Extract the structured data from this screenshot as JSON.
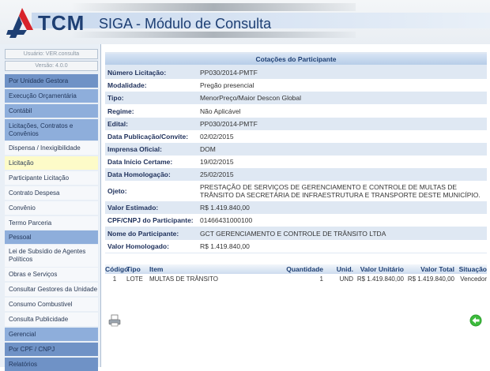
{
  "header": {
    "logo_text": "TCM",
    "title": "SIGA - Módulo de Consulta"
  },
  "sidebar": {
    "user": "Usuário: VER.consulta",
    "version": "Versão: 4.0.0",
    "items": [
      {
        "label": "Por Unidade Gestora"
      },
      {
        "label": "Execução Orçamentária"
      },
      {
        "label": "Contábil"
      },
      {
        "label": "Licitações, Contratos e Convênios"
      },
      {
        "label": "Dispensa / Inexigibilidade"
      },
      {
        "label": "Licitação"
      },
      {
        "label": "Participante Licitação"
      },
      {
        "label": "Contrato Despesa"
      },
      {
        "label": "Convênio"
      },
      {
        "label": "Termo Parceria"
      },
      {
        "label": "Pessoal"
      },
      {
        "label": "Lei de Subsídio de Agentes Políticos"
      },
      {
        "label": "Obras e Serviços"
      },
      {
        "label": "Consultar Gestores da Unidade"
      },
      {
        "label": "Consumo Combustivel"
      },
      {
        "label": "Consulta Publicidade"
      },
      {
        "label": "Gerencial"
      },
      {
        "label": "Por CPF / CNPJ"
      },
      {
        "label": "Relatórios"
      }
    ]
  },
  "main": {
    "title": "Cotações do Participante",
    "fields": [
      {
        "label": "Número Licitação:",
        "value": "PP030/2014-PMTF"
      },
      {
        "label": "Modalidade:",
        "value": "Pregão presencial"
      },
      {
        "label": "Tipo:",
        "value": "MenorPreço/Maior Descon Global"
      },
      {
        "label": "Regime:",
        "value": "Não Aplicável"
      },
      {
        "label": "Edital:",
        "value": "PP030/2014-PMTF"
      },
      {
        "label": "Data Publicação/Convite:",
        "value": "02/02/2015"
      },
      {
        "label": "Imprensa Oficial:",
        "value": "DOM"
      },
      {
        "label": "Data Início Certame:",
        "value": "19/02/2015"
      },
      {
        "label": "Data Homologação:",
        "value": "25/02/2015"
      },
      {
        "label": "Ojeto:",
        "value": "PRESTAÇÃO DE SERVIÇOS DE GERENCIAMENTO E CONTROLE DE MULTAS DE TRÂNSITO DA SECRETÁRIA DE INFRAESTRUTURA E TRANSPORTE DESTE MUNICÍPIO."
      },
      {
        "label": "Valor Estimado:",
        "value": "R$ 1.419.840,00"
      },
      {
        "label": "CPF/CNPJ do Participante:",
        "value": "01466431000100"
      },
      {
        "label": "Nome do Participante:",
        "value": "GCT GERENCIAMENTO E CONTROLE DE TRÂNSITO LTDA"
      },
      {
        "label": "Valor Homologado:",
        "value": "R$ 1.419.840,00"
      }
    ]
  },
  "items_table": {
    "columns": [
      "Código",
      "Tipo",
      "Item",
      "Quantidade",
      "Unid.",
      "Valor Unitário",
      "Valor Total",
      "Situação"
    ],
    "rows": [
      [
        "1",
        "LOTE",
        "MULTAS DE TRÂNSITO",
        "1",
        "UND",
        "R$ 1.419.840,00",
        "R$ 1.419.840,00",
        "Vencedor"
      ]
    ]
  },
  "icons": {
    "print": "printer-icon",
    "back": "back-arrow-icon"
  }
}
